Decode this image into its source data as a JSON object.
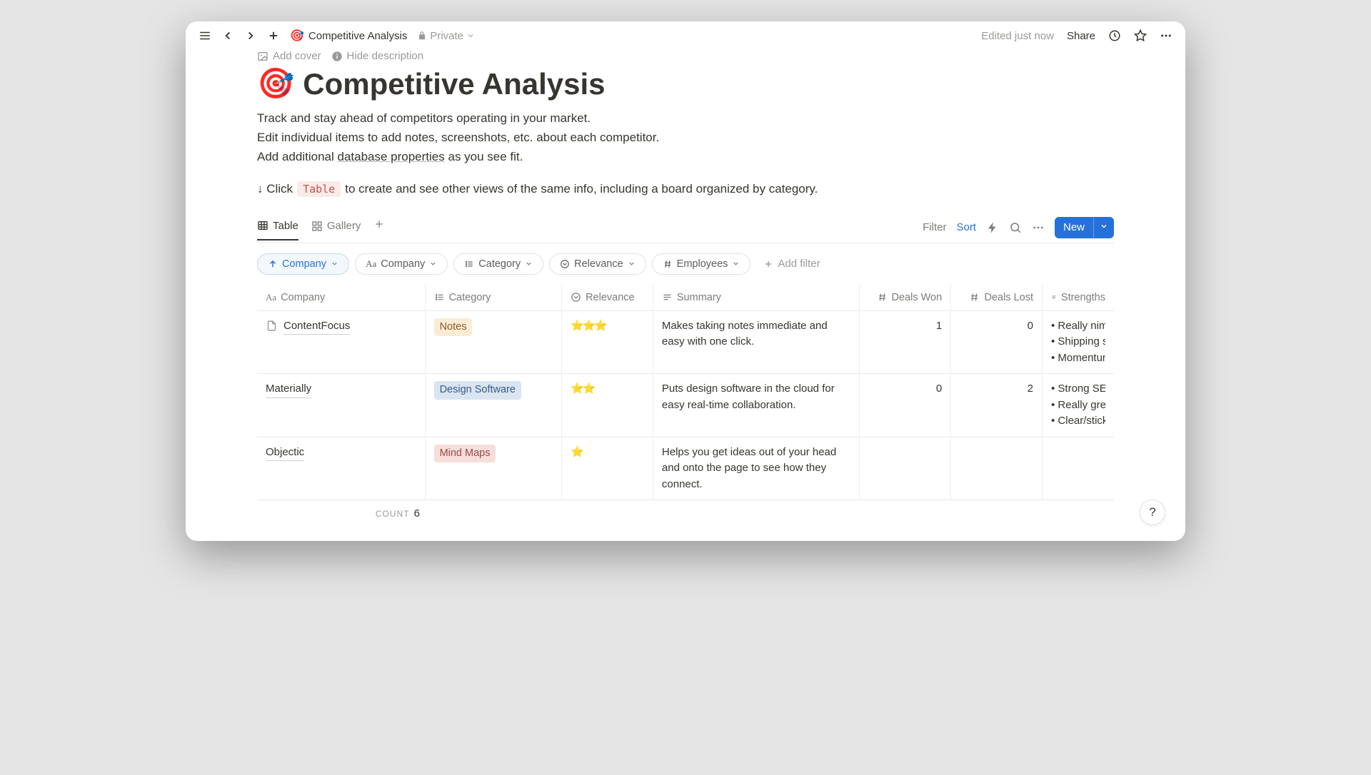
{
  "topbar": {
    "emoji": "🎯",
    "title": "Competitive Analysis",
    "privacy": "Private",
    "edited": "Edited just now",
    "share": "Share"
  },
  "pageActions": {
    "addCover": "Add cover",
    "hideDescription": "Hide description"
  },
  "page": {
    "emoji": "🎯",
    "title": "Competitive Analysis",
    "descLine1": "Track and stay ahead of competitors operating in your market.",
    "descLine2": "Edit individual items to add notes, screenshots, etc. about each competitor.",
    "descLine3Pre": "Add additional ",
    "descLine3Link": "database properties",
    "descLine3Post": " as you see fit.",
    "hintPre": "↓ Click ",
    "hintCode": "Table",
    "hintPost": " to create and see other views of the same info, including a board organized by category."
  },
  "views": {
    "table": "Table",
    "gallery": "Gallery",
    "filter": "Filter",
    "sort": "Sort",
    "new": "New"
  },
  "filters": {
    "sortPill": "Company",
    "f1": "Company",
    "f2": "Category",
    "f3": "Relevance",
    "f4": "Employees",
    "add": "Add filter"
  },
  "columns": {
    "company": "Company",
    "category": "Category",
    "relevance": "Relevance",
    "summary": "Summary",
    "dealsWon": "Deals Won",
    "dealsLost": "Deals Lost",
    "strengths": "Strengths"
  },
  "rows": [
    {
      "company": "ContentFocus",
      "showIcon": true,
      "category": "Notes",
      "categoryClass": "tag-orange",
      "relevance": "⭐⭐⭐",
      "summary": "Makes taking notes immediate and easy with one click.",
      "dealsWon": "1",
      "dealsLost": "0",
      "strengths": [
        "• Really nimb",
        "• Shipping su",
        "• Momentum after funding"
      ]
    },
    {
      "company": "Materially",
      "showIcon": false,
      "category": "Design Software",
      "categoryClass": "tag-blue",
      "relevance": "⭐⭐",
      "summary": "Puts design software in the cloud for easy real-time collaboration.",
      "dealsWon": "0",
      "dealsLost": "2",
      "strengths": [
        "• Strong SEO",
        "• Really grea",
        "• Clear/sticky"
      ]
    },
    {
      "company": "Objectic",
      "showIcon": false,
      "category": "Mind Maps",
      "categoryClass": "tag-red",
      "relevance": "⭐",
      "summary": "Helps you get ideas out of your head and onto the page to see how they connect.",
      "dealsWon": "",
      "dealsLost": "",
      "strengths": []
    }
  ],
  "footer": {
    "countLabel": "COUNT",
    "count": "6"
  },
  "help": "?"
}
